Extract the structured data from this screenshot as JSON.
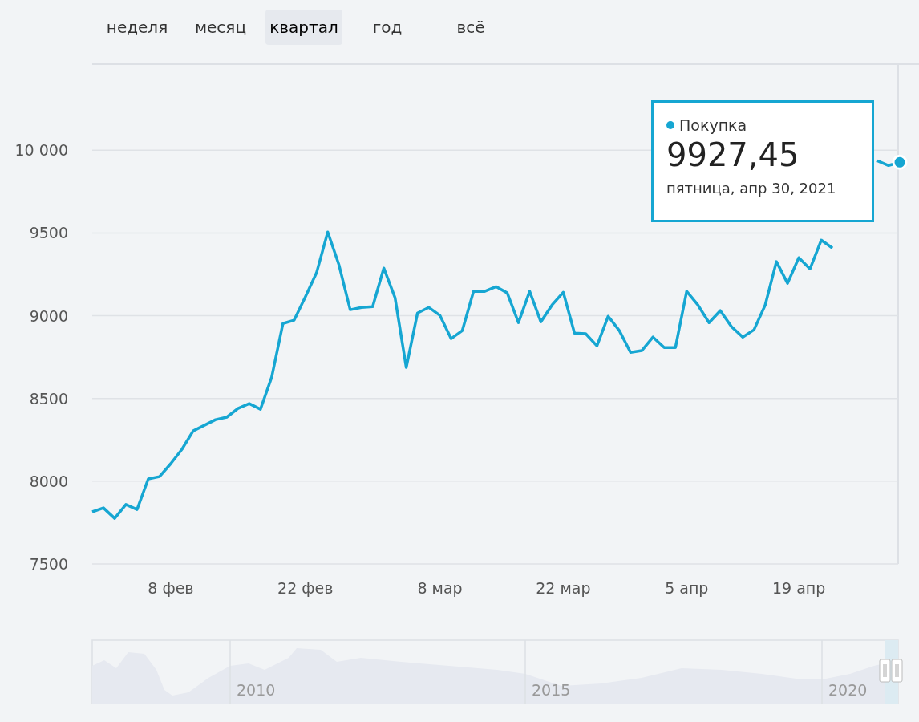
{
  "range_tabs": [
    {
      "label": "неделя",
      "selected": false
    },
    {
      "label": "месяц",
      "selected": false
    },
    {
      "label": "квартал",
      "selected": true
    },
    {
      "label": "год",
      "selected": false
    },
    {
      "label": "всё",
      "selected": false
    }
  ],
  "chart": {
    "chart_data": {
      "type": "line",
      "categories": [
        null,
        null,
        null,
        null,
        null,
        null,
        null,
        "8 фев",
        null,
        null,
        null,
        null,
        null,
        null,
        null,
        null,
        null,
        null,
        null,
        "22 фев",
        null,
        null,
        null,
        null,
        null,
        null,
        null,
        null,
        null,
        null,
        null,
        "8 мар",
        null,
        null,
        null,
        null,
        null,
        null,
        null,
        null,
        null,
        null,
        "22 мар",
        null,
        null,
        null,
        null,
        null,
        null,
        null,
        null,
        null,
        null,
        "5 апр",
        null,
        null,
        null,
        null,
        null,
        null,
        null,
        null,
        null,
        "19 апр",
        null,
        null,
        null,
        null,
        null,
        null,
        null,
        null,
        null
      ],
      "series": [
        {
          "name": "Покупка",
          "color": "#16a6d2",
          "values": [
            7815,
            7839,
            7776,
            7859,
            7829,
            8014,
            8028,
            8106,
            8193,
            8304,
            8338,
            8372,
            8387,
            8440,
            8469,
            8435,
            8629,
            8953,
            8973,
            9113,
            9259,
            9506,
            9307,
            9036,
            9050,
            9055,
            9288,
            9109,
            8687,
            9016,
            9050,
            9002,
            8861,
            8910,
            9147,
            9147,
            9176,
            9138,
            8958,
            9147,
            8963,
            9065,
            9142,
            8895,
            8891,
            8818,
            8997,
            8910,
            8779,
            8789,
            8871,
            8808,
            8808,
            9147,
            9065,
            8958,
            9031,
            8934,
            8871,
            8915,
            9065,
            9327,
            9196,
            9351,
            9283,
            9457,
            9409,
            null,
            null,
            null,
            9937,
            9908,
            9927
          ]
        }
      ],
      "ylim": [
        7500,
        10520
      ],
      "grid": true,
      "yticks": [
        {
          "value": 7500,
          "label": "7500"
        },
        {
          "value": 8000,
          "label": "8000"
        },
        {
          "value": 8500,
          "label": "8500"
        },
        {
          "value": 9000,
          "label": "9000"
        },
        {
          "value": 9500,
          "label": "9500"
        },
        {
          "value": 10000,
          "label": "10 000"
        }
      ]
    },
    "tooltip": {
      "value": "9927,45",
      "date": "пятница, апр 30, 2021"
    }
  },
  "navigator": {
    "year_labels": [
      "2010",
      "2015",
      "2020"
    ]
  }
}
